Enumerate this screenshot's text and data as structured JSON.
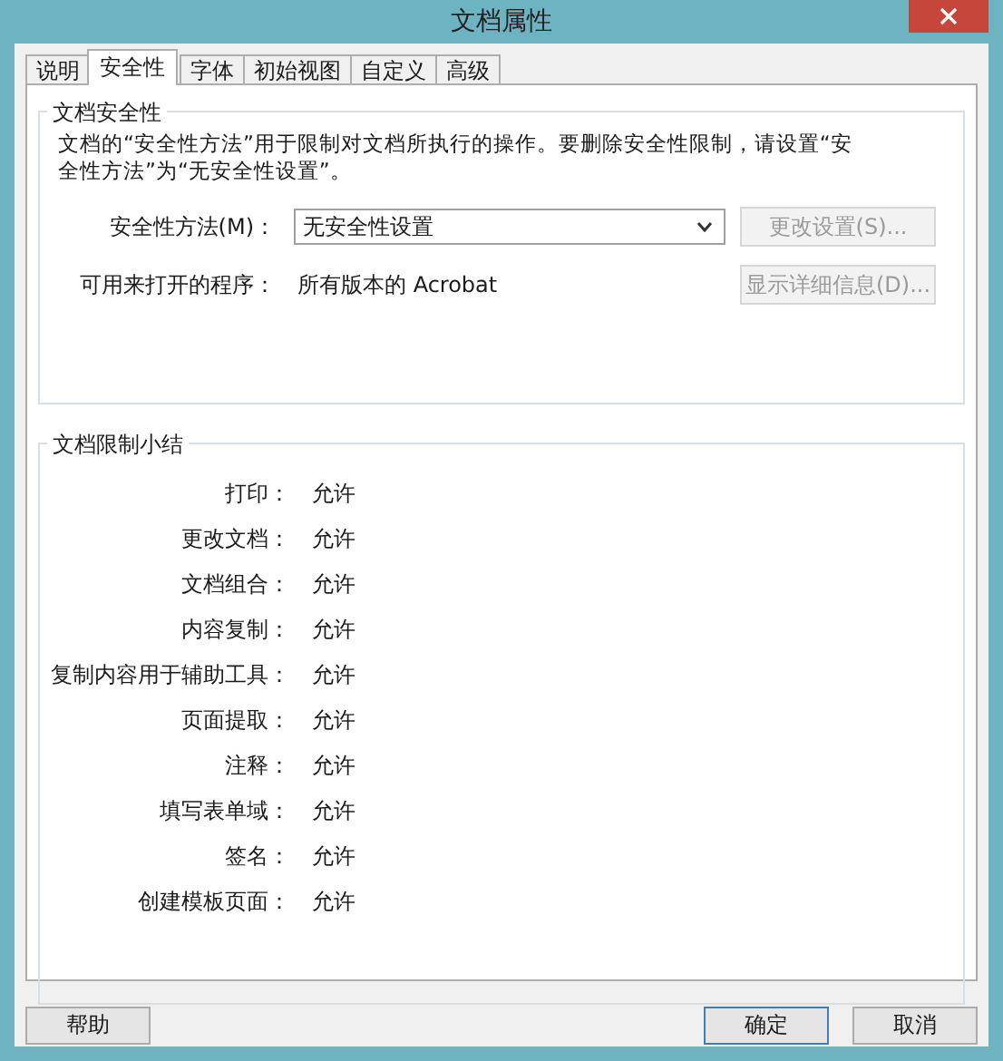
{
  "window": {
    "title": "文档属性"
  },
  "tabs": [
    {
      "label": "说明",
      "selected": false
    },
    {
      "label": "安全性",
      "selected": true
    },
    {
      "label": "字体",
      "selected": false
    },
    {
      "label": "初始视图",
      "selected": false
    },
    {
      "label": "自定义",
      "selected": false
    },
    {
      "label": "高级",
      "selected": false
    }
  ],
  "security": {
    "title": "文档安全性",
    "description": "文档的“安全性方法”用于限制对文档所执行的操作。要删除安全性限制，请设置“安全性方法”为“无安全性设置”。",
    "rows": [
      {
        "kind": "select",
        "label": "安全性方法(M)：",
        "value": "无安全性设置",
        "button": {
          "label": "更改设置(S)...",
          "disabled": true
        }
      },
      {
        "kind": "text",
        "label": "可用来打开的程序：",
        "value": "所有版本的 Acrobat",
        "button": {
          "label": "显示详细信息(D)...",
          "disabled": true
        }
      }
    ]
  },
  "restrictions": {
    "title": "文档限制小结",
    "items": [
      {
        "label": "打印：",
        "value": "允许"
      },
      {
        "label": "更改文档：",
        "value": "允许"
      },
      {
        "label": "文档组合：",
        "value": "允许"
      },
      {
        "label": "内容复制：",
        "value": "允许"
      },
      {
        "label": "复制内容用于辅助工具：",
        "value": "允许"
      },
      {
        "label": "页面提取：",
        "value": "允许"
      },
      {
        "label": "注释：",
        "value": "允许"
      },
      {
        "label": "填写表单域：",
        "value": "允许"
      },
      {
        "label": "签名：",
        "value": "允许"
      },
      {
        "label": "创建模板页面：",
        "value": "允许"
      }
    ]
  },
  "buttons": [
    {
      "label": "帮助",
      "default": false
    },
    {
      "label": "确定",
      "default": true
    },
    {
      "label": "取消",
      "default": false
    }
  ]
}
